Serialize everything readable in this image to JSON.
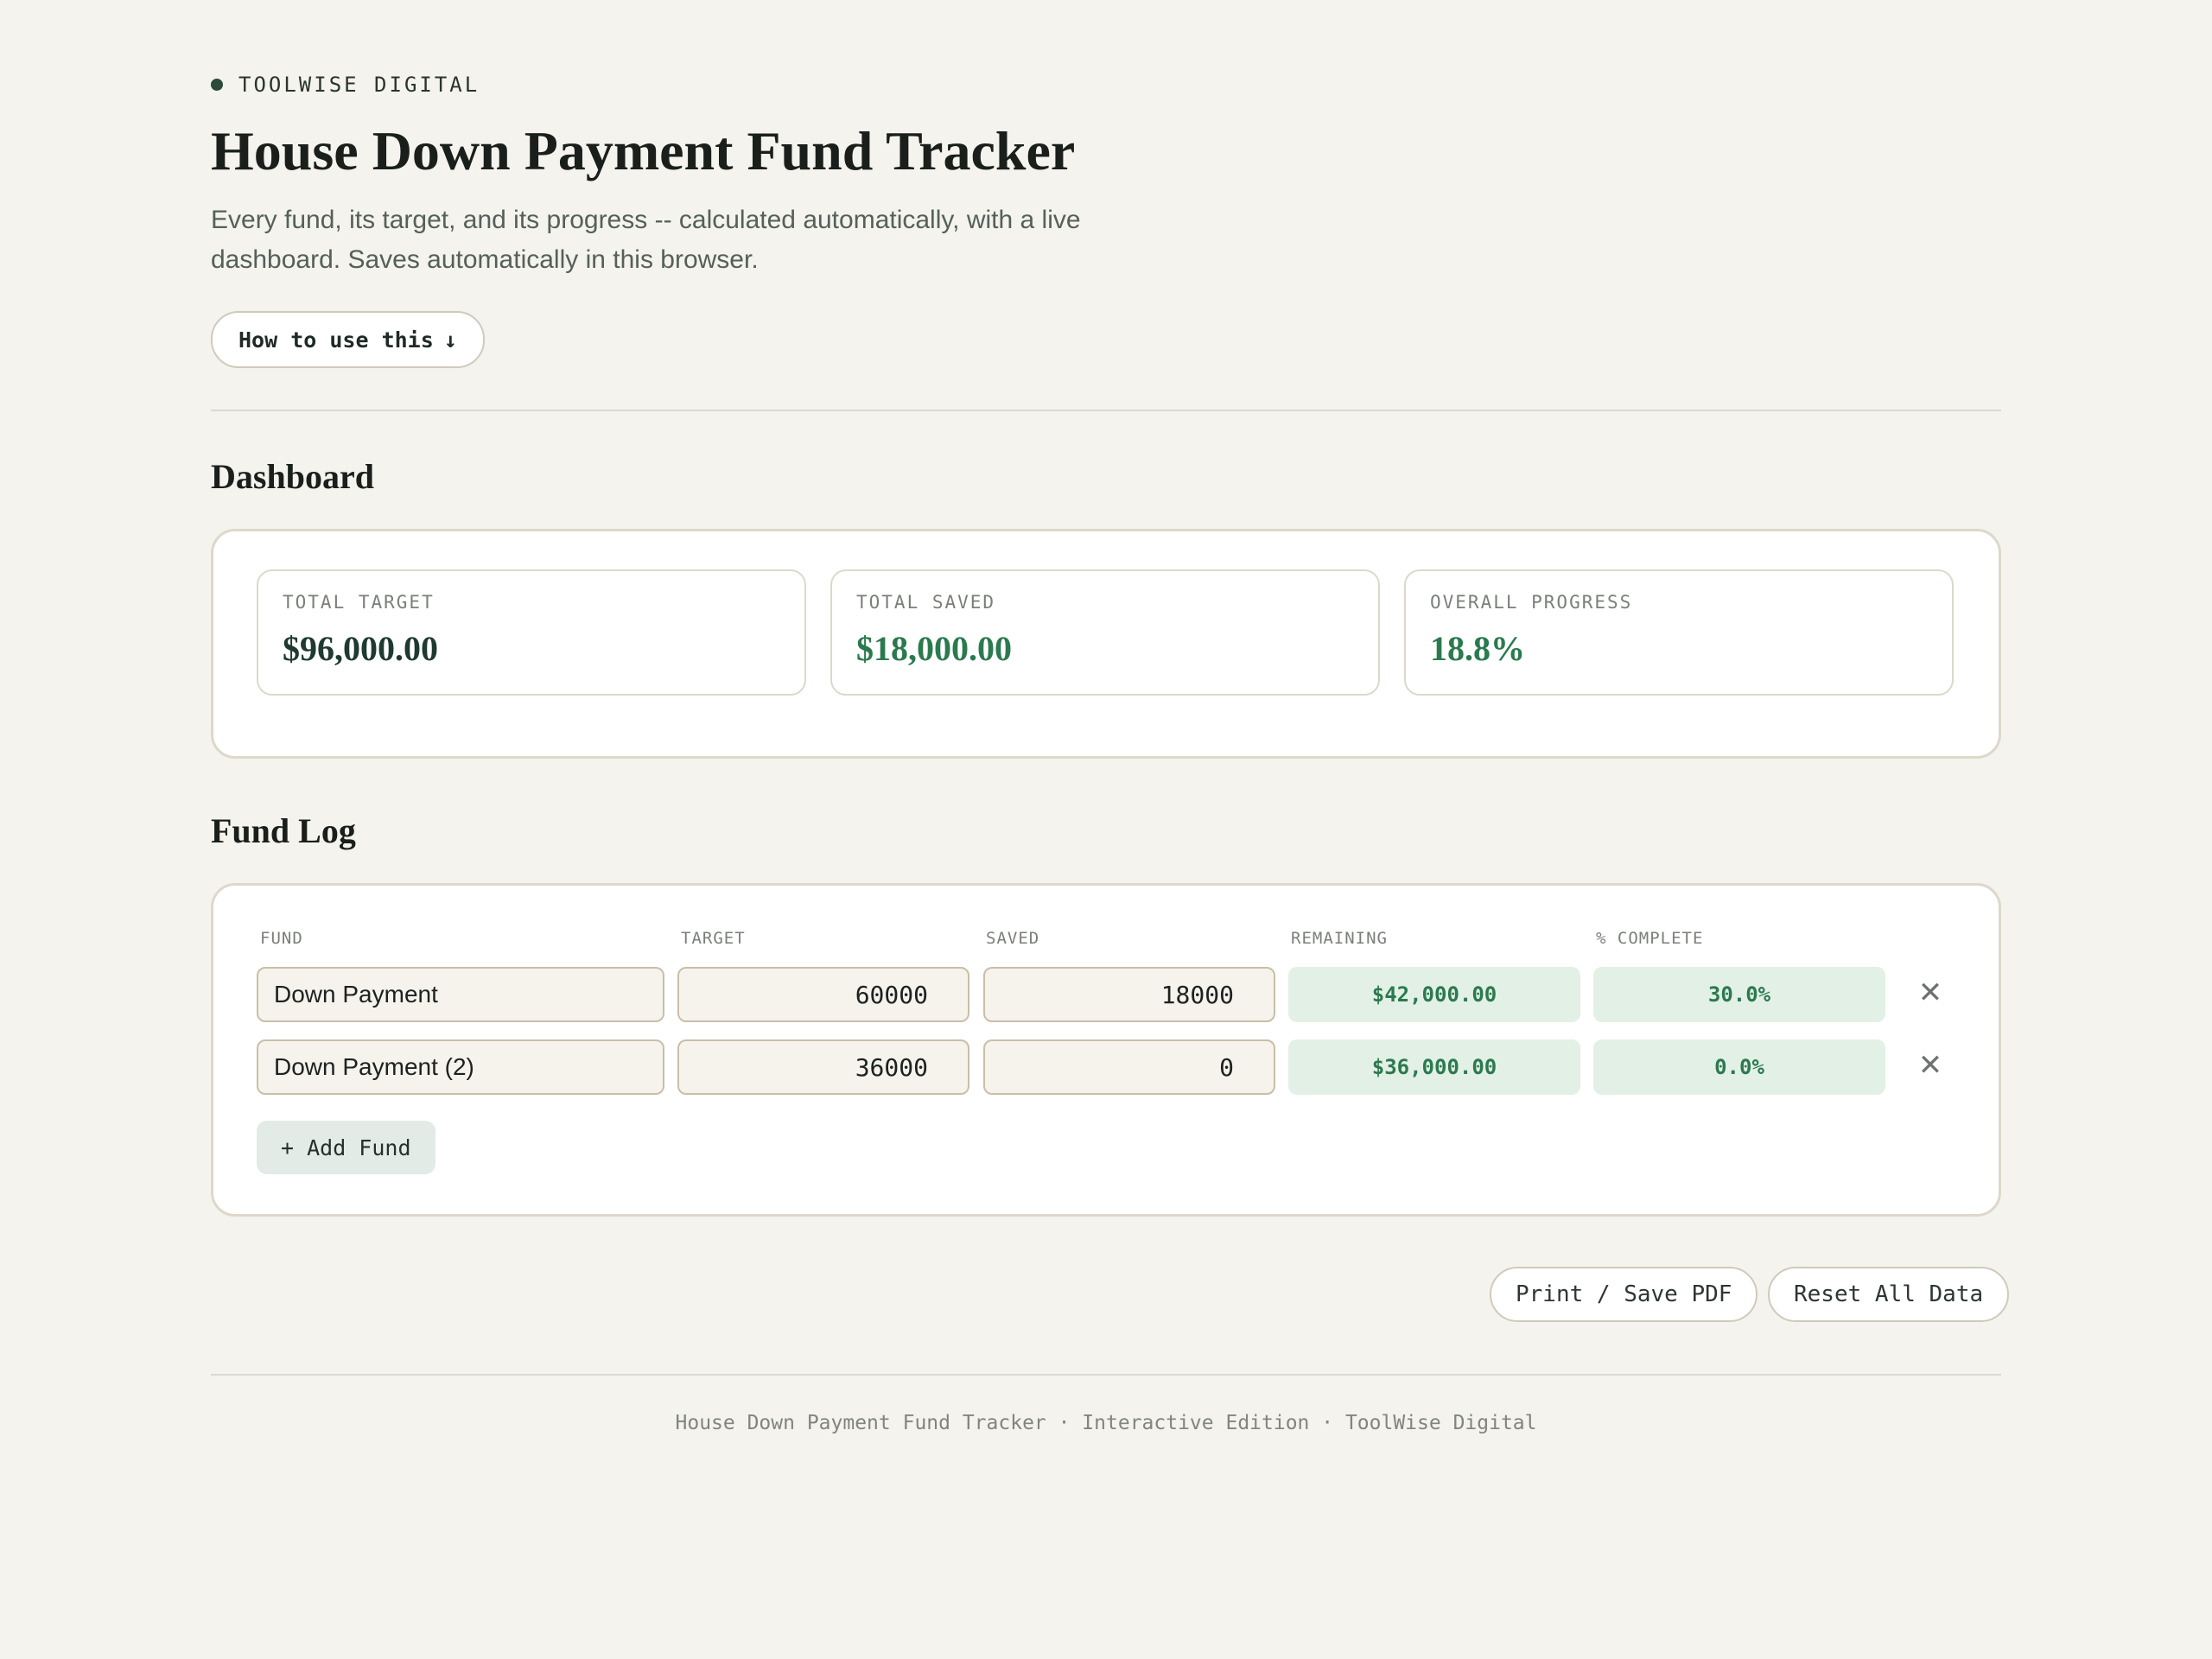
{
  "brand": {
    "name": "TOOLWISE DIGITAL"
  },
  "header": {
    "title": "House Down Payment Fund Tracker",
    "subtitle": "Every fund, its target, and its progress -- calculated automatically, with a live dashboard. Saves automatically in this browser.",
    "howto_label": "How to use this",
    "howto_arrow": "↓"
  },
  "dashboard": {
    "heading": "Dashboard",
    "stats": [
      {
        "label": "TOTAL TARGET",
        "value": "$96,000.00"
      },
      {
        "label": "TOTAL SAVED",
        "value": "$18,000.00"
      },
      {
        "label": "OVERALL PROGRESS",
        "value": "18.8%"
      }
    ]
  },
  "fund_log": {
    "heading": "Fund Log",
    "columns": [
      "FUND",
      "TARGET",
      "SAVED",
      "REMAINING",
      "% COMPLETE"
    ],
    "rows": [
      {
        "fund": "Down Payment",
        "target": "60000",
        "saved": "18000",
        "remaining": "$42,000.00",
        "complete": "30.0%"
      },
      {
        "fund": "Down Payment (2)",
        "target": "36000",
        "saved": "0",
        "remaining": "$36,000.00",
        "complete": "0.0%"
      }
    ],
    "delete_glyph": "✕",
    "add_label": "+ Add Fund"
  },
  "actions": {
    "print_label": "Print / Save PDF",
    "reset_label": "Reset All Data"
  },
  "footer": {
    "text": "House Down Payment Fund Tracker · Interactive Edition · ToolWise Digital"
  },
  "colors": {
    "accent_green": "#2b7a4f",
    "dark_value": "#1f3a30",
    "background": "#f4f3ee"
  }
}
